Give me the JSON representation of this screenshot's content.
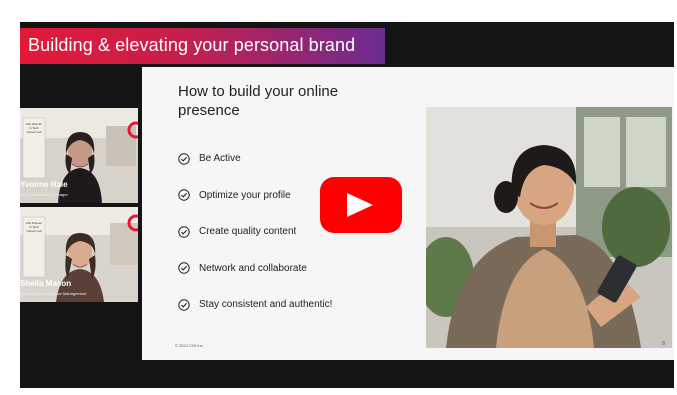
{
  "banner": {
    "title": "Building & elevating your personal brand"
  },
  "slide": {
    "title": "How to build your online presence",
    "items": [
      "Be Active",
      "Optimize your profile",
      "Create quality content",
      "Network and collaborate",
      "Stay consistent and authentic!"
    ],
    "footer": "© 2024 CGI Inc.",
    "page_number": "8"
  },
  "participants": [
    {
      "name": "Yvonne Hale",
      "role": "Talent Acquisition Manager",
      "poster_text": "CGI Women in Tech Career Lab"
    },
    {
      "name": "Sheila Mason",
      "role": "Vice President, Alliance Management",
      "poster_text": "CGI Women in Tech Career Lab"
    }
  ],
  "colors": {
    "banner_start": "#e31937",
    "banner_end": "#6b2c91",
    "play_button": "#ff0000"
  },
  "icons": {
    "play": "play-icon",
    "check": "check-circle-icon"
  }
}
